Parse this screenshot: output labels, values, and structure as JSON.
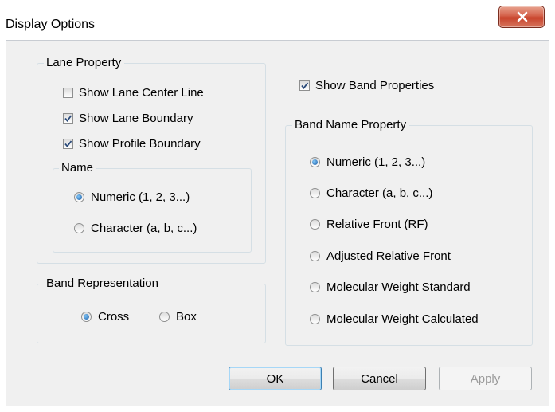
{
  "window": {
    "title": "Display Options"
  },
  "lane_property": {
    "label": "Lane Property",
    "show_center_line": {
      "label": "Show Lane Center Line",
      "checked": false
    },
    "show_lane_boundary": {
      "label": "Show Lane Boundary",
      "checked": true
    },
    "show_profile_boundary": {
      "label": "Show Profile Boundary",
      "checked": true
    },
    "name": {
      "label": "Name",
      "numeric": {
        "label": "Numeric (1, 2, 3...)",
        "selected": true
      },
      "character": {
        "label": "Character (a, b, c...)",
        "selected": false
      }
    }
  },
  "band_representation": {
    "label": "Band Representation",
    "cross": {
      "label": "Cross",
      "selected": true
    },
    "box": {
      "label": "Box",
      "selected": false
    }
  },
  "show_band_properties": {
    "label": "Show Band Properties",
    "checked": true
  },
  "band_name_property": {
    "label": "Band Name Property",
    "options": [
      {
        "label": "Numeric (1, 2, 3...)",
        "selected": true
      },
      {
        "label": "Character (a, b, c...)",
        "selected": false
      },
      {
        "label": "Relative Front (RF)",
        "selected": false
      },
      {
        "label": "Adjusted Relative Front",
        "selected": false
      },
      {
        "label": "Molecular Weight Standard",
        "selected": false
      },
      {
        "label": "Molecular Weight Calculated",
        "selected": false
      }
    ]
  },
  "buttons": {
    "ok": "OK",
    "cancel": "Cancel",
    "apply": "Apply"
  }
}
